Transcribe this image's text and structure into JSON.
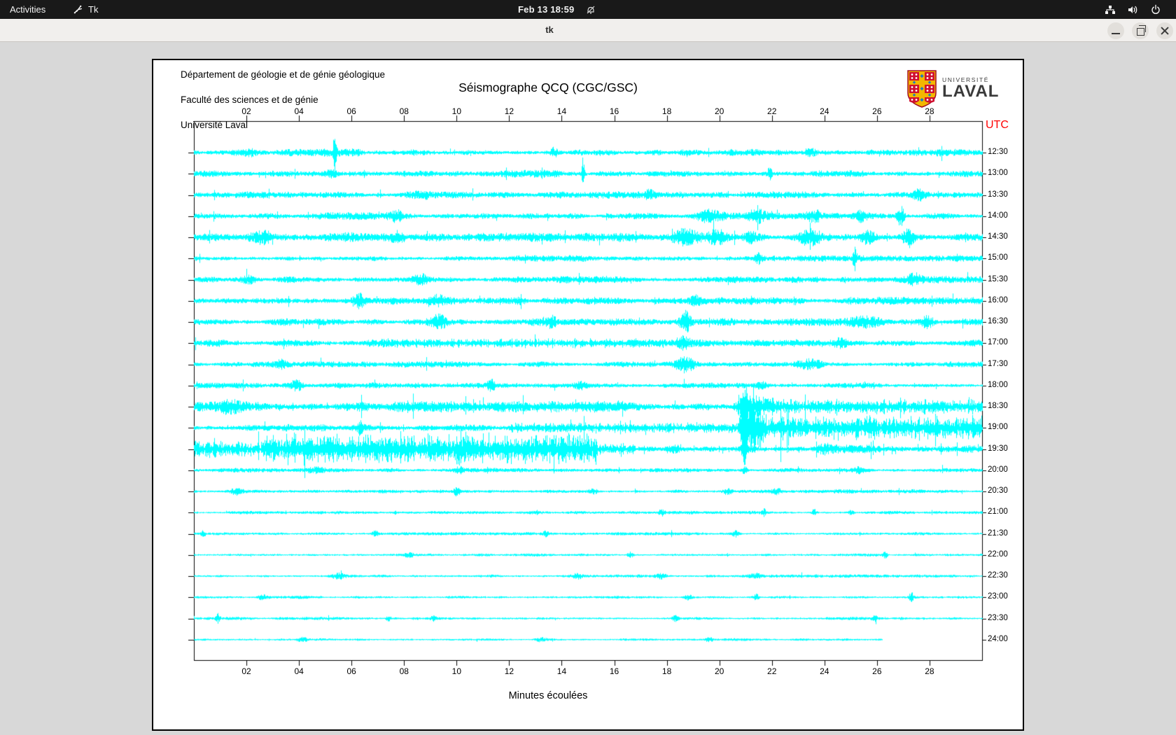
{
  "topbar": {
    "activities": "Activities",
    "app_name": "Tk",
    "clock": "Feb 13 18:59",
    "icons": [
      "tk-feather-icon",
      "bell-slash-icon",
      "network-tree-icon",
      "speaker-icon",
      "power-icon"
    ]
  },
  "titlebar": {
    "title": "tk",
    "buttons": [
      "minimize",
      "maximize",
      "close"
    ]
  },
  "window": {
    "header_line1": "Département de géologie et de génie géologique",
    "header_line2": "Faculté des sciences et de génie",
    "header_line3": "Université Laval",
    "title": "Séismographe QCQ (CGC/GSC)",
    "utc_label": "UTC",
    "xlabel": "Minutes écoulées",
    "logo_line1": "UNIVERSITÉ",
    "logo_line2": "LAVAL"
  },
  "colors": {
    "trace": "#00ffff",
    "utc_label": "#ff0000",
    "axis": "#000000",
    "desktop": "#d8d8d8",
    "logo_red": "#d01030",
    "logo_yellow": "#f3b700",
    "logo_blue": "#1f7ac0"
  },
  "chart_data": {
    "type": "line",
    "title": "Séismographe QCQ (CGC/GSC)",
    "xlabel": "Minutes écoulées",
    "x_range_minutes": [
      0,
      30
    ],
    "x_ticks": [
      "02",
      "04",
      "06",
      "08",
      "10",
      "12",
      "14",
      "16",
      "18",
      "20",
      "22",
      "24",
      "26",
      "28"
    ],
    "trace_color": "#00ffff",
    "rows": [
      {
        "t": "12:30",
        "b": 3.4,
        "sp": 0.012,
        "bursts": [
          [
            5.35,
            24,
            0.06
          ],
          [
            2.1,
            4,
            0.3
          ],
          [
            13.7,
            5,
            0.12
          ],
          [
            23.5,
            4,
            0.2
          ]
        ]
      },
      {
        "t": "13:00",
        "b": 3.4,
        "sp": 0.012,
        "bursts": [
          [
            14.8,
            20,
            0.05
          ],
          [
            5.2,
            4,
            0.25
          ],
          [
            21.9,
            6,
            0.1
          ]
        ]
      },
      {
        "t": "13:30",
        "b": 3.1,
        "sp": 0.01,
        "bursts": [
          [
            8.6,
            4,
            0.5
          ],
          [
            17.3,
            4,
            0.15
          ],
          [
            27.6,
            5,
            0.2
          ]
        ]
      },
      {
        "t": "14:00",
        "b": 3.3,
        "sp": 0.012,
        "bursts": [
          [
            7.7,
            5,
            0.2
          ],
          [
            19.6,
            7,
            0.5
          ],
          [
            21.4,
            6,
            0.35
          ],
          [
            23.6,
            6,
            0.3
          ],
          [
            26.9,
            12,
            0.12
          ],
          [
            25.4,
            6,
            0.2
          ]
        ]
      },
      {
        "t": "14:30",
        "b": 4.2,
        "sp": 0.015,
        "bursts": [
          [
            2.6,
            5,
            0.3
          ],
          [
            7.8,
            6,
            0.25
          ],
          [
            18.7,
            10,
            0.5
          ],
          [
            19.9,
            9,
            0.35
          ],
          [
            21.2,
            7,
            0.3
          ],
          [
            23.4,
            8,
            0.35
          ],
          [
            25.6,
            7,
            0.3
          ],
          [
            27.2,
            10,
            0.2
          ]
        ]
      },
      {
        "t": "15:00",
        "b": 2.7,
        "sp": 0.01,
        "bursts": [
          [
            21.5,
            5,
            0.15
          ],
          [
            25.15,
            15,
            0.07
          ]
        ]
      },
      {
        "t": "15:30",
        "b": 3.1,
        "sp": 0.01,
        "bursts": [
          [
            2.1,
            4,
            0.3
          ],
          [
            8.6,
            5,
            0.3
          ],
          [
            27.4,
            5,
            0.25
          ]
        ]
      },
      {
        "t": "16:00",
        "b": 3.3,
        "sp": 0.012,
        "bursts": [
          [
            6.3,
            7,
            0.2
          ],
          [
            9.3,
            5,
            0.25
          ],
          [
            12.4,
            4,
            0.2
          ],
          [
            19.1,
            5,
            0.2
          ]
        ]
      },
      {
        "t": "16:30",
        "b": 3.3,
        "sp": 0.012,
        "bursts": [
          [
            9.3,
            7,
            0.3
          ],
          [
            13.6,
            5,
            0.25
          ],
          [
            18.7,
            12,
            0.2
          ],
          [
            25.6,
            6,
            0.7
          ],
          [
            27.9,
            6,
            0.2
          ]
        ]
      },
      {
        "t": "17:00",
        "b": 3.3,
        "sp": 0.012,
        "segs": [
          [
            7,
            18,
            4.5
          ]
        ],
        "bursts": [
          [
            18.6,
            7,
            0.3
          ],
          [
            24.6,
            4,
            0.3
          ]
        ]
      },
      {
        "t": "17:30",
        "b": 2.7,
        "sp": 0.01,
        "bursts": [
          [
            3.3,
            4,
            0.2
          ],
          [
            18.7,
            9,
            0.35
          ],
          [
            23.4,
            5,
            0.5
          ]
        ]
      },
      {
        "t": "18:00",
        "b": 2.5,
        "sp": 0.01,
        "bursts": [
          [
            3.9,
            6,
            0.2
          ],
          [
            11.3,
            6,
            0.15
          ],
          [
            14.7,
            4,
            0.3
          ],
          [
            21.6,
            4,
            0.2
          ]
        ]
      },
      {
        "t": "18:30",
        "b": 4.8,
        "sp": 0.02,
        "sm": 3,
        "segs": [
          [
            21.3,
            30,
            7
          ]
        ],
        "bursts": [
          [
            1.3,
            6,
            0.4
          ],
          [
            20.95,
            14,
            0.25
          ],
          [
            21.5,
            8,
            0.5
          ]
        ]
      },
      {
        "t": "19:00",
        "b": 3.2,
        "sp": 0.018,
        "sm": 3.2,
        "segs": [
          [
            12,
            20.7,
            5
          ],
          [
            21.15,
            30,
            11.5
          ]
        ],
        "bursts": [
          [
            20.95,
            44,
            0.16
          ],
          [
            21.3,
            16,
            0.3
          ],
          [
            6.3,
            6,
            0.1
          ]
        ]
      },
      {
        "t": "19:30",
        "b": 3.6,
        "sp": 0.04,
        "sm": 2.8,
        "segs": [
          [
            0,
            2.5,
            8
          ],
          [
            2.55,
            15.35,
            14.5
          ],
          [
            15.4,
            16.8,
            5.5
          ]
        ],
        "bursts": [
          [
            20.95,
            17,
            0.1
          ],
          [
            18.3,
            4,
            0.2
          ],
          [
            24.0,
            3.5,
            0.3
          ]
        ]
      },
      {
        "t": "20:00",
        "b": 1.9,
        "sp": 0.008,
        "bursts": [
          [
            4.6,
            3,
            0.3
          ],
          [
            10.1,
            3.5,
            0.15
          ],
          [
            20.95,
            4,
            0.1
          ],
          [
            25.3,
            3,
            0.2
          ]
        ]
      },
      {
        "t": "20:30",
        "b": 1.8,
        "sp": 0.008,
        "bursts": [
          [
            1.6,
            3,
            0.2
          ],
          [
            10.0,
            6,
            0.12
          ],
          [
            15.2,
            3,
            0.2
          ],
          [
            20.3,
            3.5,
            0.15
          ],
          [
            22.2,
            3,
            0.15
          ]
        ]
      },
      {
        "t": "21:00",
        "b": 1.5,
        "sp": 0.006,
        "bursts": [
          [
            17.8,
            3.5,
            0.1
          ],
          [
            21.7,
            4,
            0.08
          ],
          [
            23.6,
            4.5,
            0.08
          ],
          [
            25,
            3,
            0.1
          ]
        ]
      },
      {
        "t": "21:30",
        "b": 1.5,
        "sp": 0.006,
        "bursts": [
          [
            0.35,
            5,
            0.08
          ],
          [
            6.9,
            3.5,
            0.15
          ],
          [
            13.4,
            3,
            0.1
          ],
          [
            20.6,
            3.5,
            0.12
          ]
        ]
      },
      {
        "t": "22:00",
        "b": 1.4,
        "sp": 0.006,
        "bursts": [
          [
            8.2,
            2.5,
            0.2
          ],
          [
            16.6,
            3.5,
            0.12
          ],
          [
            26.3,
            4.5,
            0.08
          ]
        ]
      },
      {
        "t": "22:30",
        "b": 1.4,
        "sp": 0.006,
        "bursts": [
          [
            5.5,
            3,
            0.25
          ],
          [
            14.6,
            3,
            0.15
          ],
          [
            17.8,
            2.5,
            0.2
          ],
          [
            21.4,
            2.5,
            0.3
          ]
        ]
      },
      {
        "t": "23:00",
        "b": 1.4,
        "sp": 0.006,
        "bursts": [
          [
            2.6,
            3,
            0.15
          ],
          [
            18.8,
            3,
            0.15
          ],
          [
            21.4,
            3.5,
            0.1
          ],
          [
            27.3,
            6.5,
            0.08
          ]
        ]
      },
      {
        "t": "23:30",
        "b": 1.4,
        "sp": 0.006,
        "bursts": [
          [
            0.9,
            5,
            0.08
          ],
          [
            7.4,
            4,
            0.08
          ],
          [
            9.1,
            3,
            0.1
          ],
          [
            18.3,
            3.5,
            0.12
          ],
          [
            25.9,
            3,
            0.1
          ]
        ]
      },
      {
        "t": "24:00",
        "b": 1.2,
        "sp": 0.005,
        "end": 26.2,
        "bursts": [
          [
            4.1,
            2.5,
            0.2
          ],
          [
            13.2,
            2.5,
            0.2
          ],
          [
            19.6,
            2.8,
            0.15
          ]
        ]
      }
    ]
  }
}
